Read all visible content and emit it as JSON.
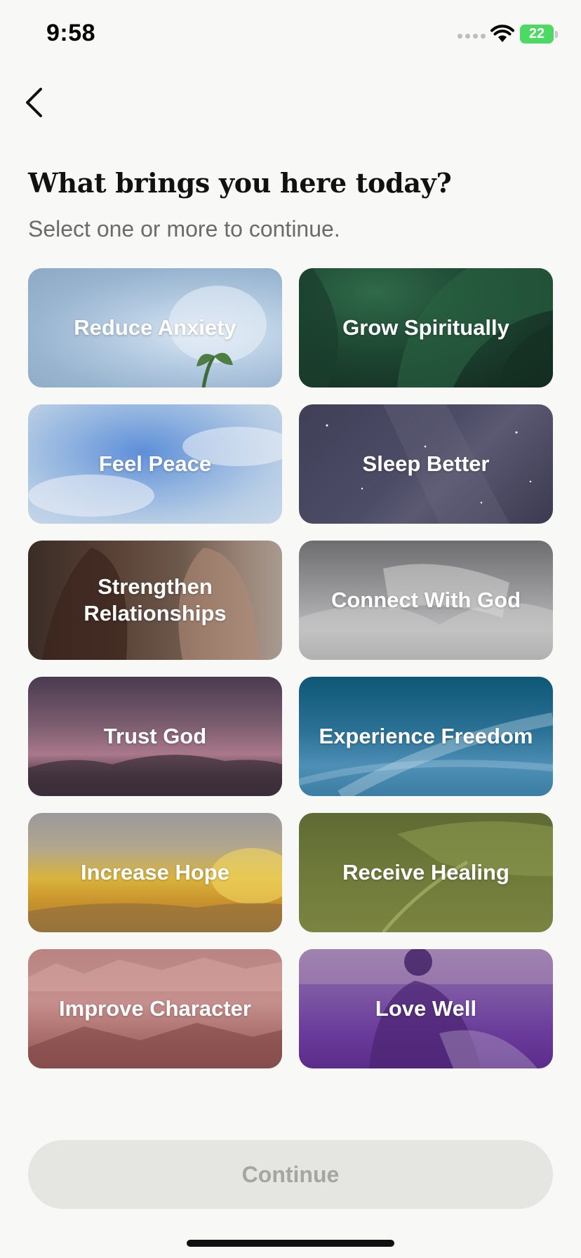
{
  "status_bar": {
    "time": "9:58",
    "battery": "22"
  },
  "header": {
    "title": "What brings you here today?",
    "subtitle": "Select one or more to continue."
  },
  "options": [
    {
      "label": "Reduce Anxiety"
    },
    {
      "label": "Grow Spiritually"
    },
    {
      "label": "Feel Peace"
    },
    {
      "label": "Sleep Better"
    },
    {
      "label": "Strengthen Relationships"
    },
    {
      "label": "Connect With God"
    },
    {
      "label": "Trust God"
    },
    {
      "label": "Experience Freedom"
    },
    {
      "label": "Increase Hope"
    },
    {
      "label": "Receive Healing"
    },
    {
      "label": "Improve Character"
    },
    {
      "label": "Love Well"
    }
  ],
  "footer": {
    "continue_label": "Continue",
    "continue_enabled": false
  },
  "icons": {
    "back": "chevron-left-icon",
    "wifi": "wifi-icon",
    "battery": "battery-icon",
    "signal": "cellular-signal-icon"
  },
  "colors": {
    "background": "#f8f8f6",
    "button_disabled_bg": "#e5e5e1",
    "button_disabled_text": "#a5a5a2",
    "battery": "#4cd964"
  }
}
